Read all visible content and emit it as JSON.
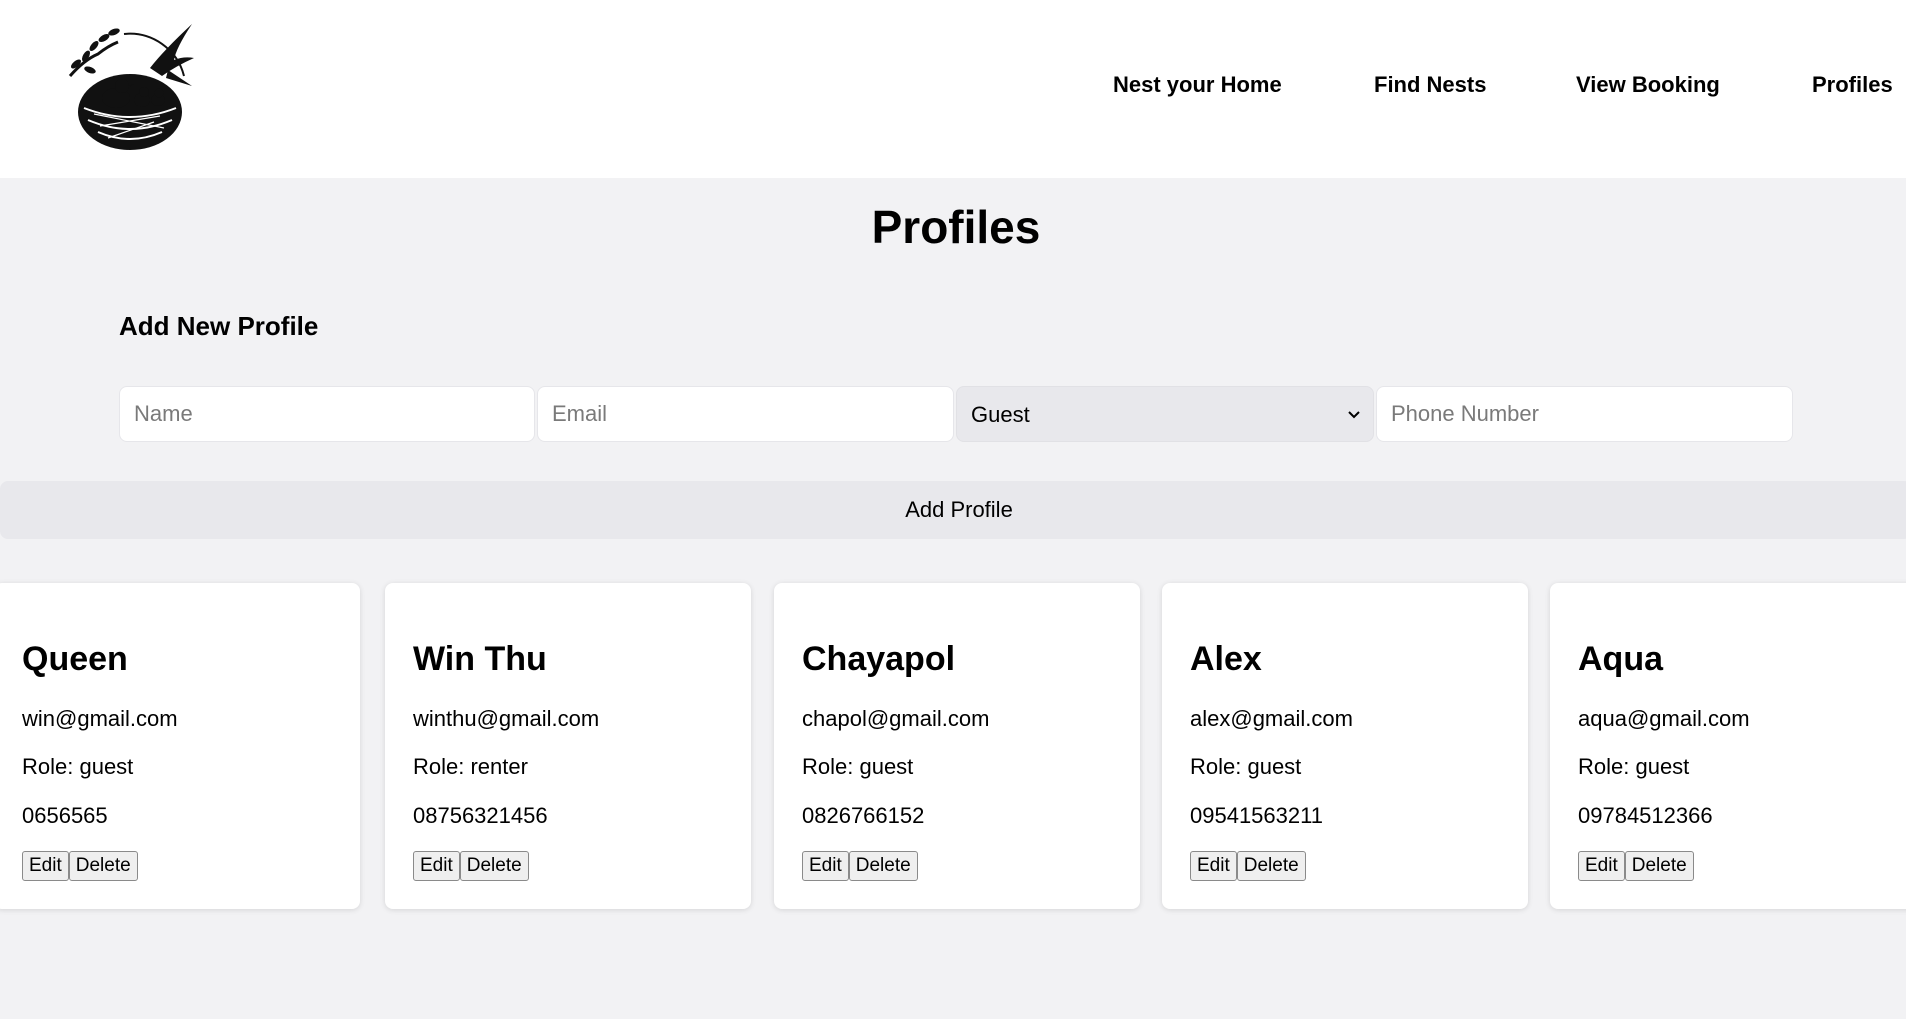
{
  "nav": {
    "items": [
      {
        "label": "Nest your Home"
      },
      {
        "label": "Find Nests"
      },
      {
        "label": "View Booking"
      },
      {
        "label": "Profiles"
      }
    ]
  },
  "page": {
    "title": "Profiles"
  },
  "form": {
    "title": "Add New Profile",
    "name_placeholder": "Name",
    "email_placeholder": "Email",
    "role_value": "Guest",
    "phone_placeholder": "Phone Number",
    "submit_label": "Add Profile"
  },
  "profiles": [
    {
      "name": "Queen",
      "email": "win@gmail.com",
      "role": "Role: guest",
      "phone": "0656565",
      "edit": "Edit",
      "delete": "Delete"
    },
    {
      "name": "Win Thu",
      "email": "winthu@gmail.com",
      "role": "Role: renter",
      "phone": "08756321456",
      "edit": "Edit",
      "delete": "Delete"
    },
    {
      "name": "Chayapol",
      "email": "chapol@gmail.com",
      "role": "Role: guest",
      "phone": "0826766152",
      "edit": "Edit",
      "delete": "Delete"
    },
    {
      "name": "Alex",
      "email": "alex@gmail.com",
      "role": "Role: guest",
      "phone": "09541563211",
      "edit": "Edit",
      "delete": "Delete"
    },
    {
      "name": "Aqua",
      "email": "aqua@gmail.com",
      "role": "Role: guest",
      "phone": "09784512366",
      "edit": "Edit",
      "delete": "Delete"
    }
  ],
  "colors": {
    "page_background": "#f2f2f4",
    "header_background": "#ffffff",
    "button_background": "#e8e8ec"
  }
}
